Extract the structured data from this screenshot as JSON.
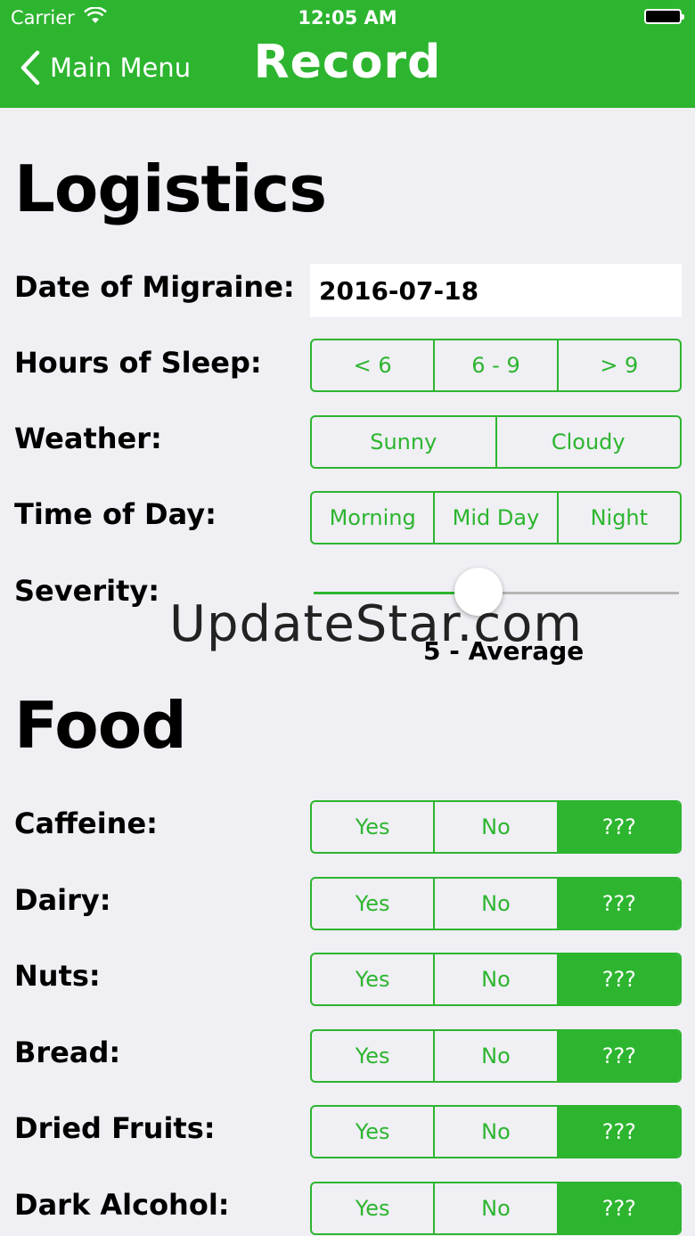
{
  "status_bar": {
    "carrier": "Carrier",
    "time": "12:05 AM"
  },
  "nav": {
    "back_label": "Main Menu",
    "title": "Record"
  },
  "logistics": {
    "heading": "Logistics",
    "date": {
      "label": "Date of Migraine:",
      "value": "2016-07-18"
    },
    "sleep": {
      "label": "Hours of Sleep:",
      "options": [
        "< 6",
        "6 - 9",
        "> 9"
      ]
    },
    "weather": {
      "label": "Weather:",
      "options": [
        "Sunny",
        "Cloudy"
      ]
    },
    "time_of_day": {
      "label": "Time of Day:",
      "options": [
        "Morning",
        "Mid Day",
        "Night"
      ]
    },
    "severity": {
      "label": "Severity:",
      "value_text": "5 - Average",
      "level": 0.5
    }
  },
  "watermark": "UpdateStar.com",
  "food": {
    "heading": "Food",
    "options": [
      "Yes",
      "No",
      "???"
    ],
    "items": [
      {
        "label": "Caffeine:",
        "selected": "???"
      },
      {
        "label": "Dairy:",
        "selected": "???"
      },
      {
        "label": "Nuts:",
        "selected": "???"
      },
      {
        "label": "Bread:",
        "selected": "???"
      },
      {
        "label": "Dried Fruits:",
        "selected": "???"
      },
      {
        "label": "Dark Alcohol:",
        "selected": "???"
      }
    ]
  },
  "colors": {
    "accent": "#2db52f",
    "background": "#efeff4"
  }
}
